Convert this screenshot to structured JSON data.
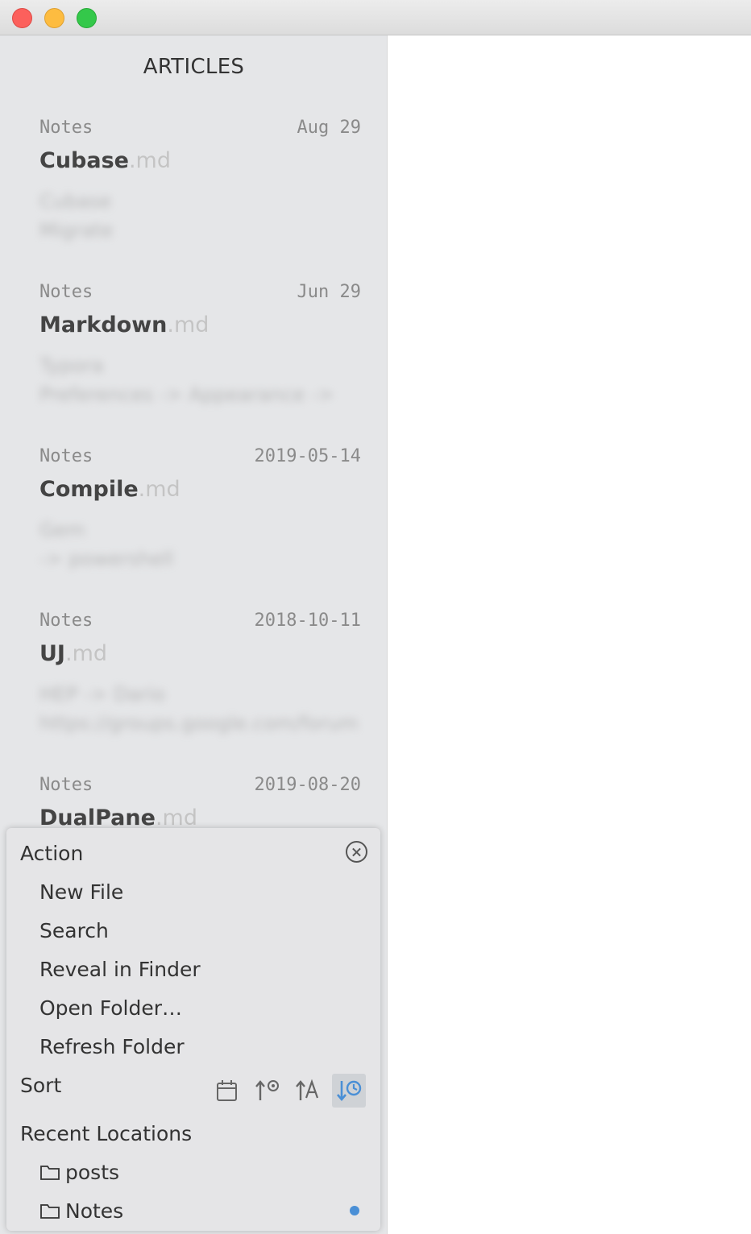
{
  "sidebar": {
    "title": "ARTICLES",
    "articles": [
      {
        "folder": "Notes",
        "date": "Aug 29",
        "name": "Cubase",
        "ext": ".md",
        "preview": [
          "Cubase",
          "Migrate"
        ]
      },
      {
        "folder": "Notes",
        "date": "Jun 29",
        "name": "Markdown",
        "ext": ".md",
        "preview": [
          "Typora",
          "Preferences -> Appearance ->"
        ]
      },
      {
        "folder": "Notes",
        "date": "2019-05-14",
        "name": "Compile",
        "ext": ".md",
        "preview": [
          "Gem",
          "-> powershell"
        ]
      },
      {
        "folder": "Notes",
        "date": "2018-10-11",
        "name": "UJ",
        "ext": ".md",
        "preview": [
          "HEP -> Dario",
          "https://groups.google.com/forum"
        ]
      },
      {
        "folder": "Notes",
        "date": "2019-08-20",
        "name": "DualPane",
        "ext": ".md",
        "preview": []
      }
    ]
  },
  "panel": {
    "action_heading": "Action",
    "actions": [
      "New File",
      "Search",
      "Reveal in Finder",
      "Open Folder…",
      "Refresh Folder"
    ],
    "sort_heading": "Sort",
    "sort_icons": [
      "sort-by-folder-icon",
      "sort-by-created-icon",
      "sort-by-name-icon",
      "sort-by-modified-icon"
    ],
    "sort_active_index": 3,
    "recent_heading": "Recent Locations",
    "recent": [
      {
        "name": "posts",
        "active": false
      },
      {
        "name": "Notes",
        "active": true
      }
    ],
    "accent_color": "#4a8fd6"
  }
}
